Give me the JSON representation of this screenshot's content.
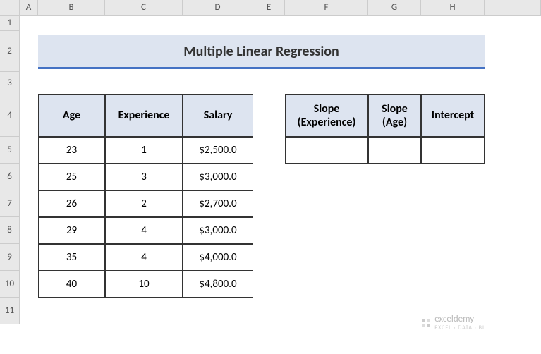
{
  "title": "Multiple Linear Regression",
  "columns": [
    "A",
    "B",
    "C",
    "D",
    "E",
    "F",
    "G",
    "H"
  ],
  "rows": [
    "1",
    "2",
    "3",
    "4",
    "5",
    "6",
    "7",
    "8",
    "9",
    "10",
    "11"
  ],
  "table1": {
    "headers": {
      "age": "Age",
      "experience": "Experience",
      "salary": "Salary"
    },
    "data": [
      {
        "age": "23",
        "experience": "1",
        "salary": "$2,500.0"
      },
      {
        "age": "25",
        "experience": "3",
        "salary": "$3,000.0"
      },
      {
        "age": "26",
        "experience": "2",
        "salary": "$2,700.0"
      },
      {
        "age": "29",
        "experience": "4",
        "salary": "$3,000.0"
      },
      {
        "age": "35",
        "experience": "4",
        "salary": "$4,000.0"
      },
      {
        "age": "40",
        "experience": "10",
        "salary": "$4,800.0"
      }
    ]
  },
  "table2": {
    "headers": {
      "slope_exp": "Slope (Experience)",
      "slope_age": "Slope (Age)",
      "intercept": "Intercept"
    }
  },
  "watermark": {
    "brand": "exceldemy",
    "tagline": "EXCEL · DATA · BI"
  },
  "chart_data": {
    "type": "table",
    "title": "Multiple Linear Regression",
    "columns": [
      "Age",
      "Experience",
      "Salary"
    ],
    "rows": [
      [
        23,
        1,
        2500.0
      ],
      [
        25,
        3,
        3000.0
      ],
      [
        26,
        2,
        2700.0
      ],
      [
        29,
        4,
        3000.0
      ],
      [
        35,
        4,
        4000.0
      ],
      [
        40,
        10,
        4800.0
      ]
    ],
    "output_columns": [
      "Slope (Experience)",
      "Slope (Age)",
      "Intercept"
    ]
  }
}
